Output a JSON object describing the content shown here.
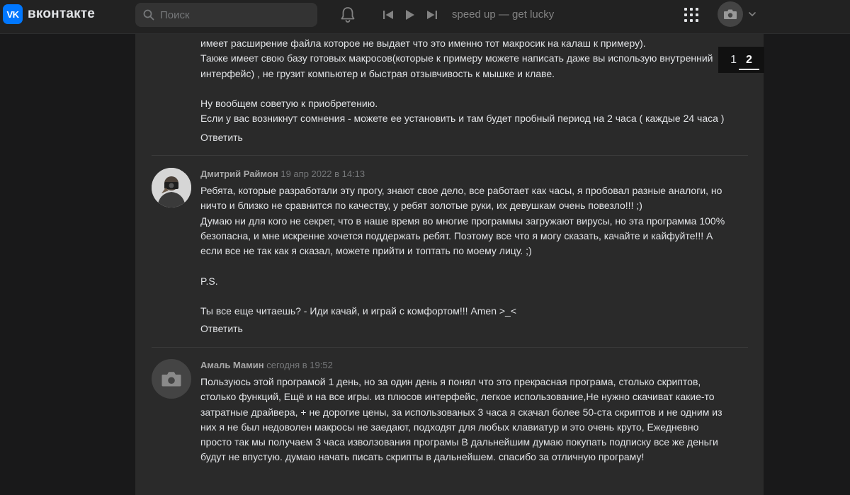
{
  "header": {
    "logo_mark": "VK",
    "logo_text": "вконтакте",
    "search_placeholder": "Поиск",
    "track": "speed up — get lucky"
  },
  "pager": [
    "1",
    "2"
  ],
  "previous_comment": {
    "lines": [
      "имеет расширение файла которое не выдает что это именно тот макросик на калаш к примеру).",
      "Также имеет свою базу готовых макросов(которые к примеру можете написать даже вы использую внутренний",
      "интерфейс) , не грузит компьютер и быстрая отзывчивость к мышке и клаве.",
      "",
      "Ну вообщем советую к приобретению.",
      "Если у вас возникнут сомнения - можете ее установить и там будет пробный период на 2 часа ( каждые 24 часа )"
    ],
    "reply": "Ответить"
  },
  "comments": [
    {
      "author": "Дмитрий Раймон",
      "date": "19 апр 2022 в 14:13",
      "lines": [
        "Ребята, которые разработали эту прогу, знают свое дело, все работает как часы, я пробовал разные аналоги, но",
        "ничто и близко не сравнится по качеству, у ребят золотые руки, их девушкам очень повезло!!! ;)",
        "Думаю ни для кого не секрет, что в наше время во многие программы загружают вирусы, но эта программа 100%",
        "безопасна, и мне искренне хочется поддержать ребят. Поэтому все что я могу сказать, качайте и кайфуйте!!! А",
        "если все не так как я сказал, можете прийти и топтать по моему лицу. ;)",
        "",
        "P.S.",
        "",
        "Ты все еще читаешь? - Иди качай, и играй с комфортом!!! Amen >_<"
      ],
      "reply": "Ответить"
    },
    {
      "author": "Амаль Мамин",
      "date": "сегодня в 19:52",
      "lines": [
        "Пользуюсь этой програмой 1 день, но за один день я понял что это прекрасная програма, столько скриптов,",
        "столько функций, Ещё и на все игры. из плюсов интерфейс, легкое использование,Не нужно скачиват какие-то",
        "затратные драйвера, + не дорогие цены, за использованых 3 часа я скачал более 50-ста скриптов и не одним из",
        "них я не был недоволен макросы не заедают, подходят для любых клавиатур и это очень круто, Ежедневно",
        "просто так мы получаем 3 часа изволзования програмы В дальнейшим думаю покупать подписку все же деньги",
        "будут не впустую. думаю начать писать скрипты в дальнейшем. спасибо за отличную програму!"
      ]
    }
  ]
}
